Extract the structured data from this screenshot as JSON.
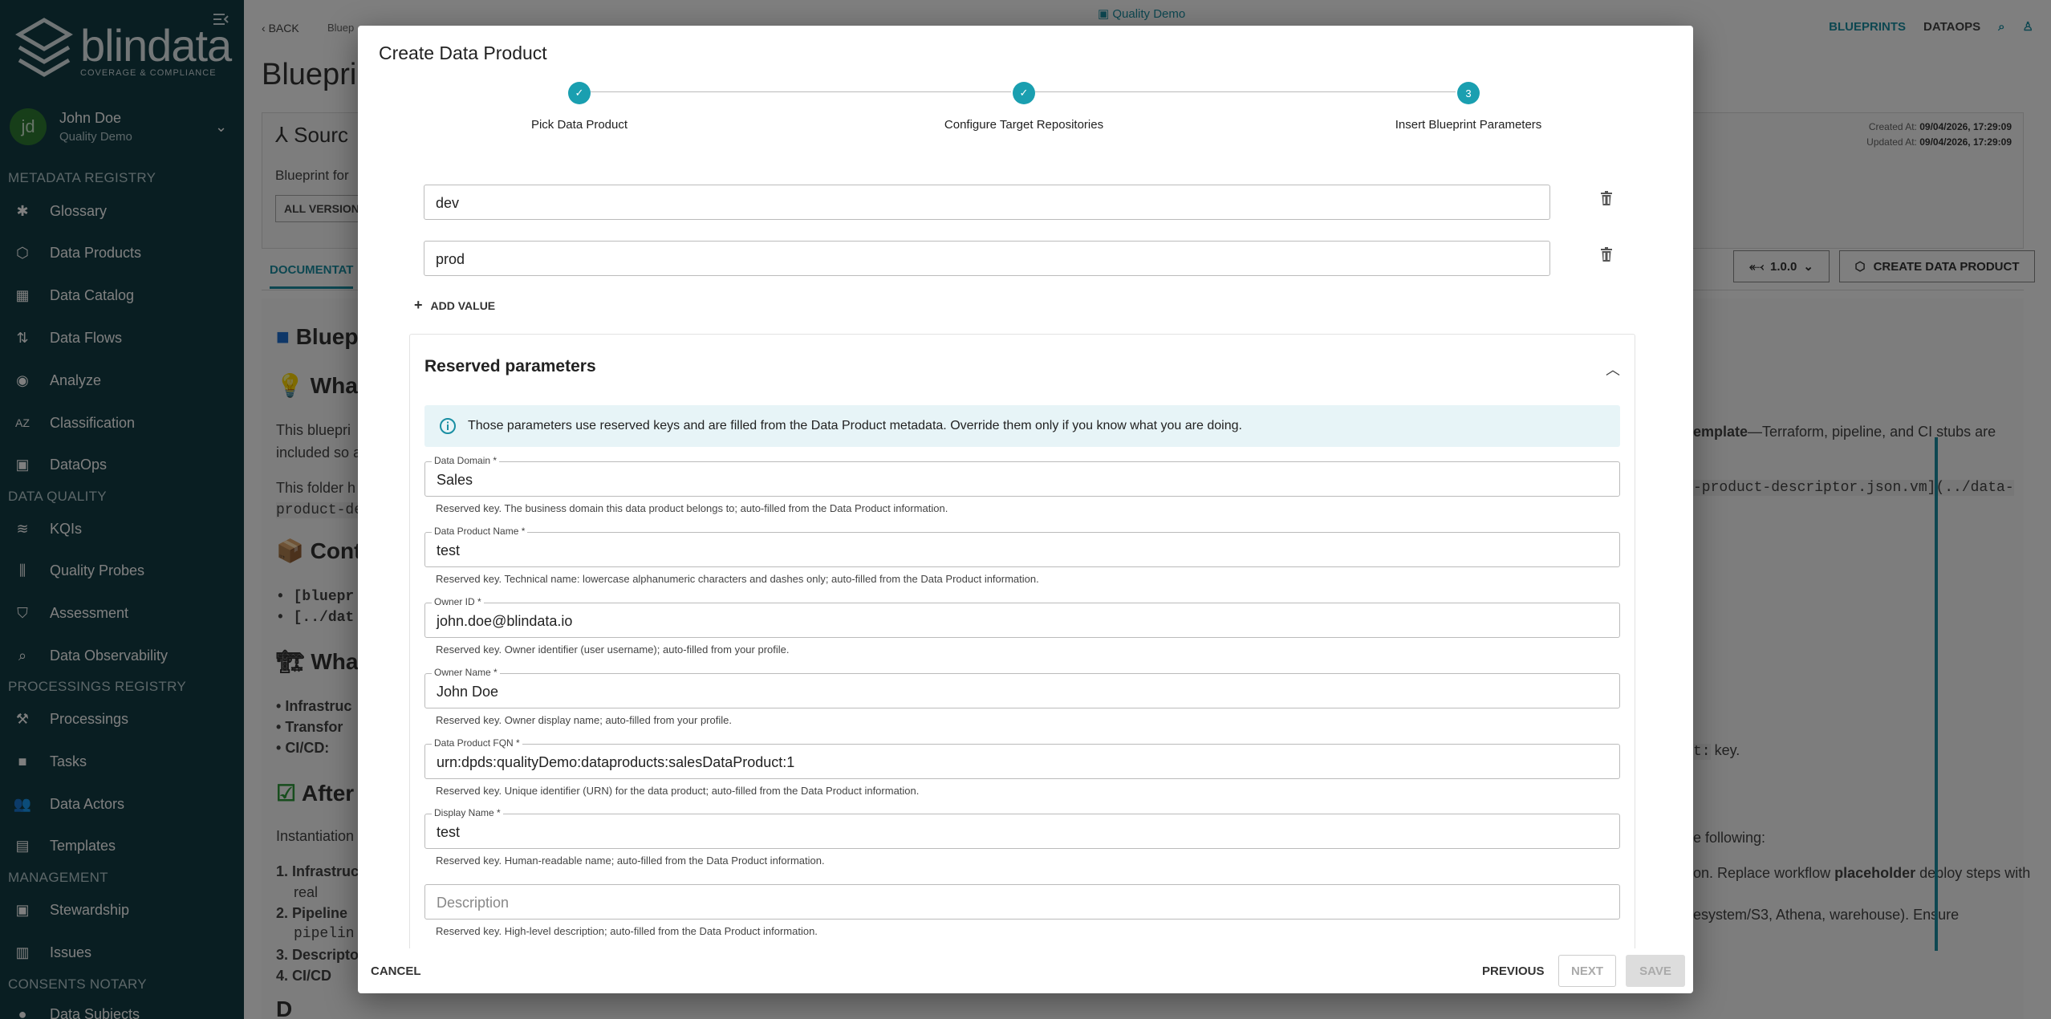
{
  "sidebar": {
    "logo_name": "blindata",
    "logo_tagline": "COVERAGE & COMPLIANCE",
    "user": {
      "initials": "jd",
      "name": "John Doe",
      "tenant": "Quality Demo"
    },
    "sections": [
      {
        "title": "METADATA REGISTRY",
        "items": [
          "Glossary",
          "Data Products",
          "Data Catalog",
          "Data Flows",
          "Analyze",
          "Classification",
          "DataOps"
        ]
      },
      {
        "title": "DATA QUALITY",
        "items": [
          "KQIs",
          "Quality Probes",
          "Assessment",
          "Data Observability"
        ]
      },
      {
        "title": "PROCESSINGS REGISTRY",
        "items": [
          "Processings",
          "Tasks",
          "Data Actors",
          "Templates"
        ]
      },
      {
        "title": "MANAGEMENT",
        "items": [
          "Stewardship",
          "Issues"
        ]
      },
      {
        "title": "CONSENTS NOTARY",
        "items": [
          "Data Subjects"
        ]
      }
    ]
  },
  "page": {
    "back_label": "BACK",
    "breadcrumb": "Bluep",
    "tenant_label": "Quality Demo",
    "topnav": {
      "blueprints": "BLUEPRINTS",
      "dataops": "DATAOPS"
    },
    "title": "Bluepri",
    "card_title": "Sourc",
    "card_desc": "Blueprint for",
    "all_versions": "ALL VERSION",
    "created_label": "Created At:",
    "created_value": "09/04/2026, 17:29:09",
    "updated_label": "Updated At:",
    "updated_value": "09/04/2026, 17:29:09",
    "tab_documentation": "DOCUMENTAT",
    "version_value": "1.0.0",
    "create_data_product_btn": "CREATE DATA PRODUCT",
    "doc": {
      "h1": "Bluep",
      "h2": "What",
      "p1a": "This bluepri",
      "p1b": "included so a",
      "p2a": "This folder h",
      "p2b": "product-des",
      "h3": "Cont",
      "li1": "[bluepr",
      "li2": "[../dat",
      "h4": "What",
      "li3": "Infrastruc",
      "li4": "Transfor",
      "li5": "CI/CD:",
      "h5": "After",
      "p3": "Instantiation",
      "ol1": "Infrastruc",
      "ol1b": "real",
      "ol2": "Pipeline",
      "ol2b": "pipelin",
      "ol3": "Descripto",
      "ol4": "CI/CD",
      "h6": "D",
      "r1": "emplate",
      "r1b": "—Terraform, pipeline, and CI stubs are",
      "r2": "-product-descriptor.json.vm](../data-",
      "r3": "t:",
      "r3b": "key.",
      "r4": "e following:",
      "r5": "on. Replace workflow",
      "r5b": "placeholder",
      "r5c": "deploy steps with",
      "r6": "esystem/S3, Athena, warehouse). Ensure"
    }
  },
  "dialog": {
    "title": "Create Data Product",
    "steps": [
      {
        "label": "Pick Data Product",
        "state": "done"
      },
      {
        "label": "Configure Target Repositories",
        "state": "done"
      },
      {
        "label": "Insert Blueprint Parameters",
        "state": "active",
        "number": "3"
      }
    ],
    "values": [
      "dev",
      "prod"
    ],
    "add_value": "ADD VALUE",
    "reserved": {
      "title": "Reserved parameters",
      "info": "Those parameters use reserved keys and are filled from the Data Product metadata. Override them only if you know what you are doing.",
      "fields": [
        {
          "label": "Data Domain *",
          "value": "Sales",
          "helper": "Reserved key. The business domain this data product belongs to; auto-filled from the Data Product information."
        },
        {
          "label": "Data Product Name *",
          "value": "test",
          "helper": "Reserved key. Technical name: lowercase alphanumeric characters and dashes only; auto-filled from the Data Product information."
        },
        {
          "label": "Owner ID *",
          "value": "john.doe@blindata.io",
          "helper": "Reserved key. Owner identifier (user username); auto-filled from your profile."
        },
        {
          "label": "Owner Name *",
          "value": "John Doe",
          "helper": "Reserved key. Owner display name; auto-filled from your profile."
        },
        {
          "label": "Data Product FQN *",
          "value": "urn:dpds:qualityDemo:dataproducts:salesDataProduct:1",
          "helper": "Reserved key. Unique identifier (URN) for the data product; auto-filled from the Data Product information."
        },
        {
          "label": "Display Name *",
          "value": "test",
          "helper": "Reserved key. Human-readable name; auto-filled from the Data Product information."
        }
      ],
      "description_placeholder": "Description",
      "description_helper": "Reserved key. High-level description; auto-filled from the Data Product information."
    },
    "footer": {
      "cancel": "CANCEL",
      "previous": "PREVIOUS",
      "next": "NEXT",
      "save": "SAVE"
    }
  },
  "colors": {
    "sidebar_bg": "#123d45",
    "accent": "#1a9fb0",
    "overlay": "rgba(0,0,0,0.5)"
  }
}
